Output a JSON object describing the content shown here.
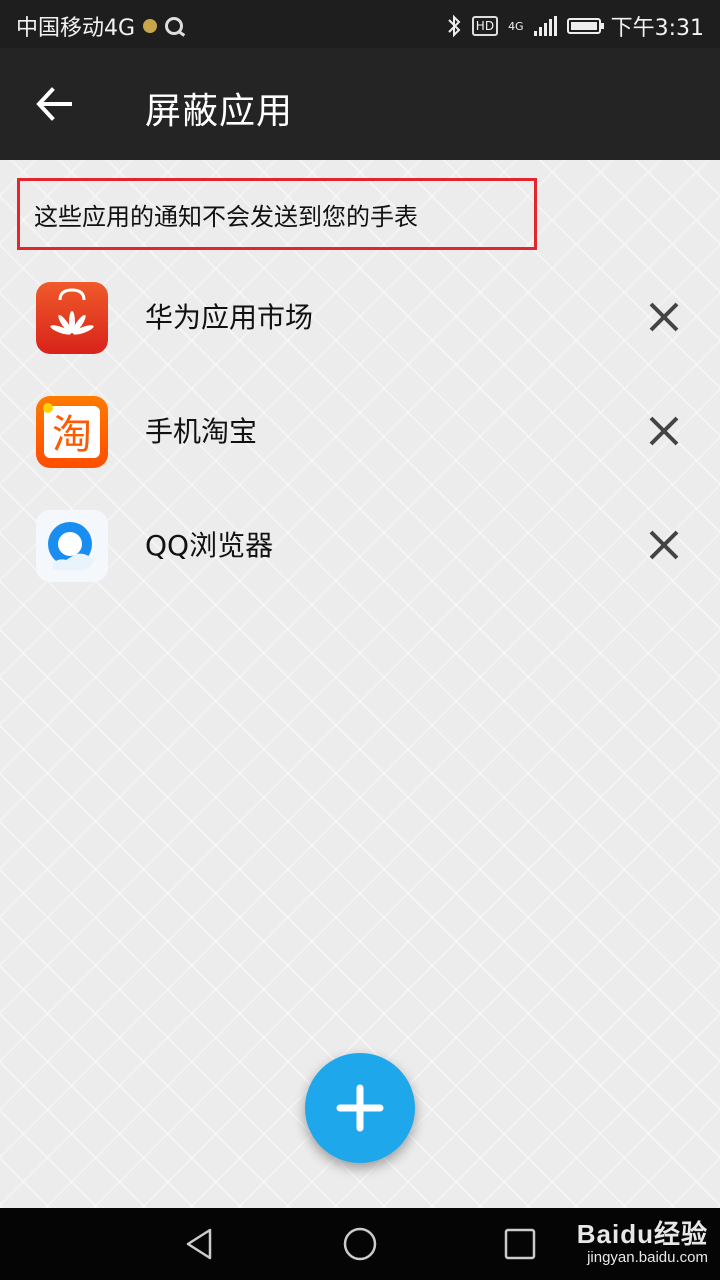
{
  "status_bar": {
    "carrier": "中国移动4G",
    "hd_badge": "HD",
    "network_badge": "4G",
    "time": "下午3:31",
    "icons": [
      "notification-dot-icon",
      "q-browser-icon",
      "bluetooth-icon",
      "hd-icon",
      "signal-icon",
      "battery-icon"
    ]
  },
  "app_bar": {
    "title": "屏蔽应用",
    "back_icon": "back-arrow-icon"
  },
  "notice": {
    "text": "这些应用的通知不会发送到您的手表",
    "border_color": "#e3262d"
  },
  "apps": [
    {
      "name": "华为应用市场",
      "icon": "huawei-appgallery-icon",
      "icon_color": "#e83b1c"
    },
    {
      "name": "手机淘宝",
      "icon": "taobao-icon",
      "icon_char": "淘",
      "icon_color": "#ff5a00"
    },
    {
      "name": "QQ浏览器",
      "icon": "qq-browser-icon",
      "icon_color": "#1a8ef0"
    }
  ],
  "fab": {
    "label": "+",
    "color": "#1fa7ec"
  },
  "nav_bar": {
    "buttons": [
      "back-triangle-icon",
      "home-circle-icon",
      "recents-square-icon"
    ]
  },
  "watermark": {
    "brand": "Baidu经验",
    "url": "jingyan.baidu.com"
  }
}
